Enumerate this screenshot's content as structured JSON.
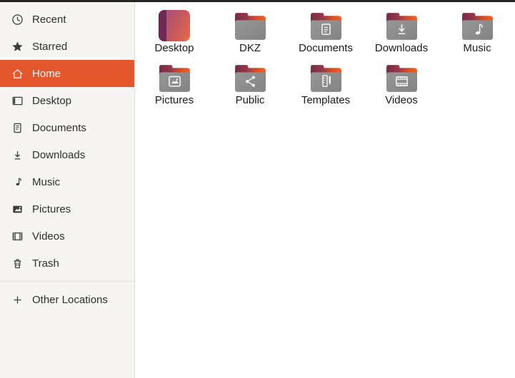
{
  "window": {
    "top_edge_color": "#262626"
  },
  "sidebar": {
    "background_color": "#F6F5F4",
    "selection_color": "#E4562B",
    "selected_item": "Home",
    "items": [
      {
        "label": "Recent",
        "icon": "clock-icon",
        "selected": false
      },
      {
        "label": "Starred",
        "icon": "star-icon",
        "selected": false
      },
      {
        "label": "Home",
        "icon": "home-icon",
        "selected": true
      },
      {
        "label": "Desktop",
        "icon": "desktop-panel-icon",
        "selected": false
      },
      {
        "label": "Documents",
        "icon": "document-icon",
        "selected": false
      },
      {
        "label": "Downloads",
        "icon": "download-arrow-icon",
        "selected": false
      },
      {
        "label": "Music",
        "icon": "music-note-icon",
        "selected": false
      },
      {
        "label": "Pictures",
        "icon": "picture-icon",
        "selected": false
      },
      {
        "label": "Videos",
        "icon": "film-strip-icon",
        "selected": false
      },
      {
        "label": "Trash",
        "icon": "trash-icon",
        "selected": false
      }
    ],
    "footer_item": {
      "label": "Other Locations",
      "icon": "plus-icon"
    }
  },
  "files": [
    {
      "name": "Desktop",
      "icon": "desktop-wallpaper-icon"
    },
    {
      "name": "DKZ",
      "icon": "folder-plain-icon"
    },
    {
      "name": "Documents",
      "icon": "folder-document-icon"
    },
    {
      "name": "Downloads",
      "icon": "folder-download-icon"
    },
    {
      "name": "Music",
      "icon": "folder-music-icon"
    },
    {
      "name": "Pictures",
      "icon": "folder-picture-icon"
    },
    {
      "name": "Public",
      "icon": "folder-share-icon"
    },
    {
      "name": "Templates",
      "icon": "folder-template-icon"
    },
    {
      "name": "Videos",
      "icon": "folder-video-icon"
    }
  ],
  "icon_colors": {
    "folder_front_gray_light": "#979797",
    "folder_front_gray_dark": "#838383",
    "folder_flap_maroon": "#7A2A45",
    "folder_flap_orange": "#ED6328",
    "folder_glyph_white": "#F4F4F4",
    "desktop_strip_purple": "#6E2A54",
    "desktop_gradient_start": "#A74B7E",
    "desktop_gradient_end": "#E86B43"
  }
}
